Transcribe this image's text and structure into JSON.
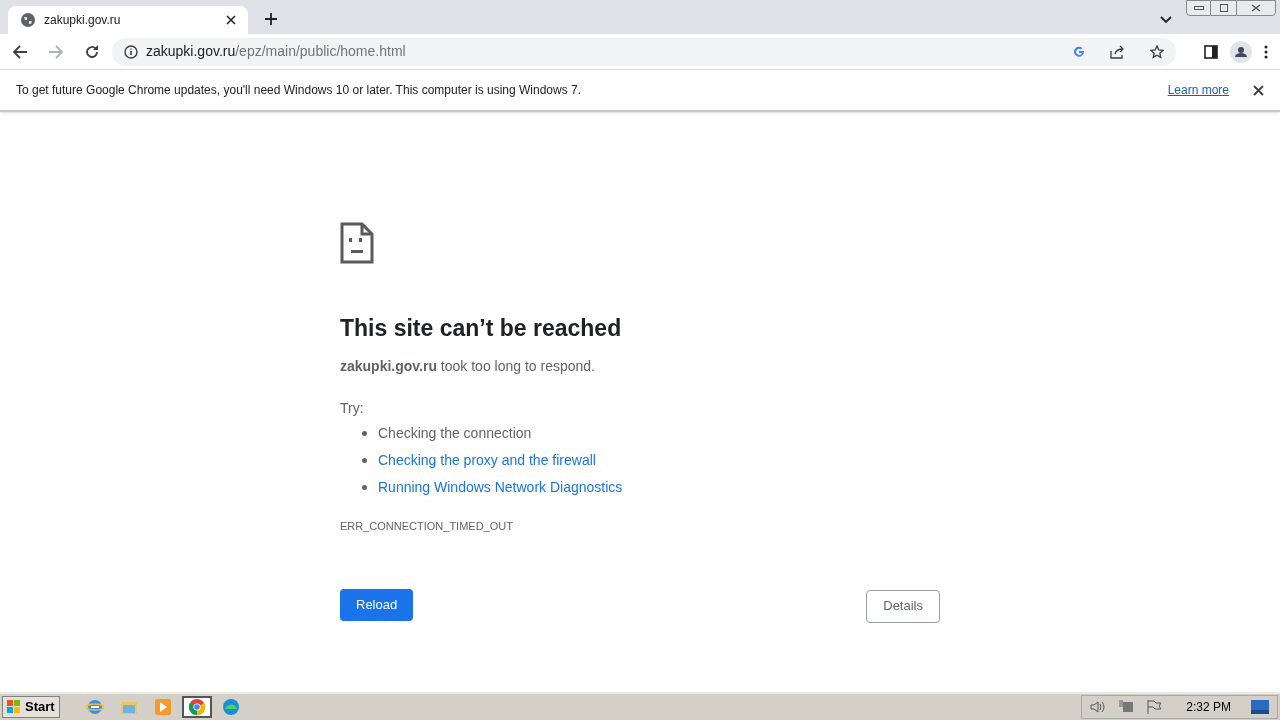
{
  "tab": {
    "title": "zakupki.gov.ru",
    "selected": true
  },
  "address": {
    "host": "zakupki.gov.ru",
    "path": "/epz/main/public/home.html"
  },
  "infobar": {
    "message": "To get future Google Chrome updates, you'll need Windows 10 or later. This computer is using Windows 7.",
    "link": "Learn more"
  },
  "error": {
    "title": "This site can’t be reached",
    "description": "**zakupki.gov.ru** took too long to respond.",
    "try_label": "Try:",
    "suggestions": [
      {
        "kind": "text",
        "text": "Checking the connection"
      },
      {
        "kind": "link",
        "text": "Checking the proxy and the firewall"
      },
      {
        "kind": "link",
        "text": "Running Windows Network Diagnostics"
      }
    ],
    "code": "ERR_CONNECTION_TIMED_OUT",
    "buttons": {
      "reload": "Reload",
      "details": "Details"
    }
  },
  "taskbar": {
    "start": "Start",
    "apps": [
      {
        "kind": "ie",
        "selected": false
      },
      {
        "kind": "explorer",
        "selected": false
      },
      {
        "kind": "media",
        "selected": false
      },
      {
        "kind": "chrome",
        "selected": true
      },
      {
        "kind": "edge",
        "selected": false
      }
    ],
    "clock": "2:32 PM"
  }
}
